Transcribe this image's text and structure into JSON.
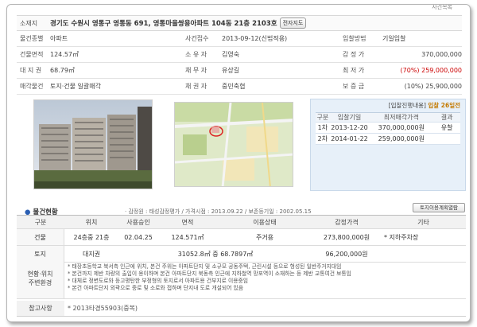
{
  "header": {
    "corner": "사건목록"
  },
  "property": {
    "address_label": "소재지",
    "address": "경기도 수원시 영통구 영통동 691, 영통마을쌍용아파트 104동 21층 2103호",
    "map_button": "전자지도",
    "rows": [
      {
        "l1": "물건종별",
        "v1": "아파트",
        "l2": "사건접수",
        "v2": "2013-09-12(신법적용)",
        "l3": "입찰방법",
        "v3": "기일입찰"
      },
      {
        "l1": "건물면적",
        "v1": "124.57㎡",
        "l2": "소 유 자",
        "v2": "김영숙",
        "l3": "감 정 가",
        "v3": "370,000,000"
      },
      {
        "l1": "대 지 권",
        "v1": "68.79㎡",
        "l2": "채 무 자",
        "v2": "유상길",
        "l3": "최 저 가",
        "v3": "(70%) 259,000,000"
      },
      {
        "l1": "매각물건",
        "v1": "토지·건물 일괄매각",
        "l2": "채 권 자",
        "v2": "중민축협",
        "l3": "보 증 금",
        "v3": "(10%) 25,900,000"
      }
    ]
  },
  "bids": {
    "title": "[입찰진행내용]",
    "highlight": "입찰 26일전",
    "headers": [
      "구분",
      "입찰기일",
      "최저매각가격",
      "결과"
    ],
    "rows": [
      [
        "1차",
        "2013-12-20",
        "370,000,000원",
        "유찰"
      ],
      [
        "2차",
        "2014-01-22",
        "259,000,000원",
        ""
      ]
    ]
  },
  "status": {
    "title": "물건현황",
    "meta": "· 감정원 : 태성감정평가 / 가격시점 : 2013.09.22 / 보존등기일 : 2002.05.15",
    "land_button": "토지이용계획열람",
    "headers": [
      "구분",
      "위치",
      "사용승인",
      "면적",
      "이용상태",
      "감정가격",
      "기타"
    ],
    "building": {
      "label": "건물",
      "location": "24층중 21층",
      "approval": "02.04.25",
      "area": "124.571㎡",
      "usage": "주거용",
      "price": "273,800,000원"
    },
    "land": {
      "label": "토지",
      "location": "대지권",
      "area": "31052.8㎡ 중 68.7897㎡",
      "price": "96,200,000원"
    },
    "other": "* 지하주차장",
    "env_label_1": "현황·위치",
    "env_label_2": "주변환경",
    "env_lines": [
      "* 태장초등학교 북서측 인근에 위치, 본건 주위는 아파트단지 및 소규모 공동주택, 근린시설 등으로 형성된 일반주거지대임",
      "* 본건까지 제반 차량의 출입이 용이하며 본건 아파트단지 북동측 인근에 지하철역 망포역이 소재하는 등 제반 교통여건 보통임",
      "* 대체로 정변도로와 등고평탄한 부정형의 토지로서 아파트용 건부지로 이용중임",
      "* 본건 아파트단지 외곽으로 중로 및 소로와 접하며 단지내 도로 개설되어 있음"
    ],
    "note_label": "참고사항",
    "note_value": "* 2013타경55903(중복)"
  }
}
